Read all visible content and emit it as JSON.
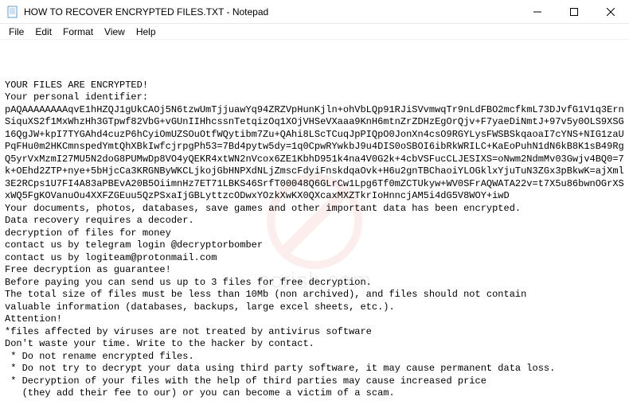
{
  "window": {
    "title": "HOW TO RECOVER ENCRYPTED FILES.TXT - Notepad"
  },
  "menu": {
    "items": [
      "File",
      "Edit",
      "Format",
      "View",
      "Help"
    ]
  },
  "body": {
    "l1": "YOUR FILES ARE ENCRYPTED!",
    "l2": "Your personal identifier:",
    "l3": "pAQAAAAAAAAqvE1hHZQJ1gUkCAOj5N6tzwUmTjjuawYq94ZRZVpHunKjln+ohVbLQp91RJiSVvmwqTr9nLdFBO2mcfkmL73DJvfG1V1q3ErnSiquXS2f1MxWhzHh3GTpwf82VbG+vGUnIIHhcssnTetqizOq1XOjVHSeVXaaa9KnH6mtnZrZDHzEgOrQjv+F7yaeDiNmtJ+97v5y0OLS9XSG16QgJW+kpI7TYGAhd4cuzP6hCyiOmUZSOuOtfWQytibm7Zu+QAhi8LScTCuqJpPIQpO0JonXn4csO9RGYLysFWSBSkqaoaI7cYNS+NIG1zaUPqFHu0m2HKCmnspedYmtQhXBkIwfcjrpgPh53=7Bd4pytw5dy=1q0CpwRYwkbJ9u4DIS0oSBOI6ibRkWRILC+KaEoPuhN1dN6kB8K1sB49RgQ5yrVxMzmI27MU5N2doG8PUMwDp8VO4yQEKR4xtWN2nVcox6ZE1KbhD951k4na4V0G2k+4cbVSFucCLJESIXS=oNwm2NdmMv03Gwjv4BQ0=7k+OEhd2ZTP+nye+5bHjcCa3KRGNByWKCLjkojGbHNPXdNLjZmscFdyiFnskdqaOvk+H6u2gnTBChaoiYLOGklxYjuTuN3ZGx3pBkwK=ajXml3E2RCps1U7FI4A83aPBEvA20B5OiimnHz7ET71LBKS46SrfT00048Q6GLrCw1Lpg6Tf0mZCTUkyw+WV0SFrAQWATA22v=t7X5u86bwnOGrXSxWQ5FgKOVanuOu4XXFZGEuu5QzPSxaIjGBLyttzcODwxYOzkXwKX0QXcaxMXZTkrIoHnncjAM5i4dG5V8WOY+iwD",
    "l4": "",
    "l5": "",
    "l6": "Your documents, photos, databases, save games and other important data has been encrypted.",
    "l7": "Data recovery requires a decoder.",
    "l8": "decryption of files for money",
    "l9": "contact us by telegram login @decryptorbomber",
    "l10": "contact us by logiteam@protonmail.com",
    "l11": "Free decryption as guarantee!",
    "l12": "Before paying you can send us up to 3 files for free decryption.",
    "l13": "The total size of files must be less than 10Mb (non archived), and files should not contain",
    "l14": "valuable information (databases, backups, large excel sheets, etc.).",
    "l15": "",
    "l16": "",
    "l17": "Attention!",
    "l18": "*files affected by viruses are not treated by antivirus software",
    "l19": "Don't waste your time. Write to the hacker by contact.",
    "l20": " * Do not rename encrypted files.",
    "l21": " * Do not try to decrypt your data using third party software, it may cause permanent data loss.",
    "l22": " * Decryption of your files with the help of third parties may cause increased price",
    "l23": "   (they add their fee to our) or you can become a victim of a scam."
  },
  "watermark": {
    "text": "pcrisk.com"
  }
}
